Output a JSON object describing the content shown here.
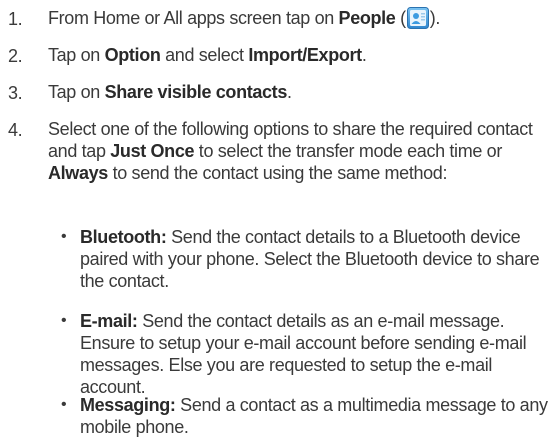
{
  "steps": [
    {
      "num": "1.",
      "pre": "From Home or All apps screen tap on ",
      "b1": "People",
      "mid": " (",
      "post": ")."
    },
    {
      "num": "2.",
      "pre": "Tap on ",
      "b1": "Option",
      "mid": " and select ",
      "b2": "Import/Export",
      "post": "."
    },
    {
      "num": "3.",
      "pre": "Tap on ",
      "b1": "Share visible contacts",
      "post": "."
    },
    {
      "num": "4.",
      "pre": "Select one of the following options to share the required contact and tap ",
      "b1": "Just Once",
      "mid": " to select the transfer mode each time or ",
      "b2": "Always",
      "post": " to send the contact using the same method:"
    }
  ],
  "bullets": [
    {
      "symbol": "•",
      "title": "Bluetooth:",
      "text": " Send the contact details to a Bluetooth device paired with your phone. Select the Bluetooth device to share the contact."
    },
    {
      "symbol": "•",
      "title": "E-mail:",
      "text": " Send the contact details as an e-mail message. Ensure to setup your e-mail account before sending e-mail messages. Else you are requested to setup the e-mail account."
    },
    {
      "symbol": "•",
      "title": "Messaging:",
      "text": " Send a contact as a multimedia message to any mobile phone."
    }
  ],
  "icons": {
    "people": "people-app-icon"
  },
  "colors": {
    "text": "#3a3a3a",
    "icon_blue": "#3d9be0"
  }
}
